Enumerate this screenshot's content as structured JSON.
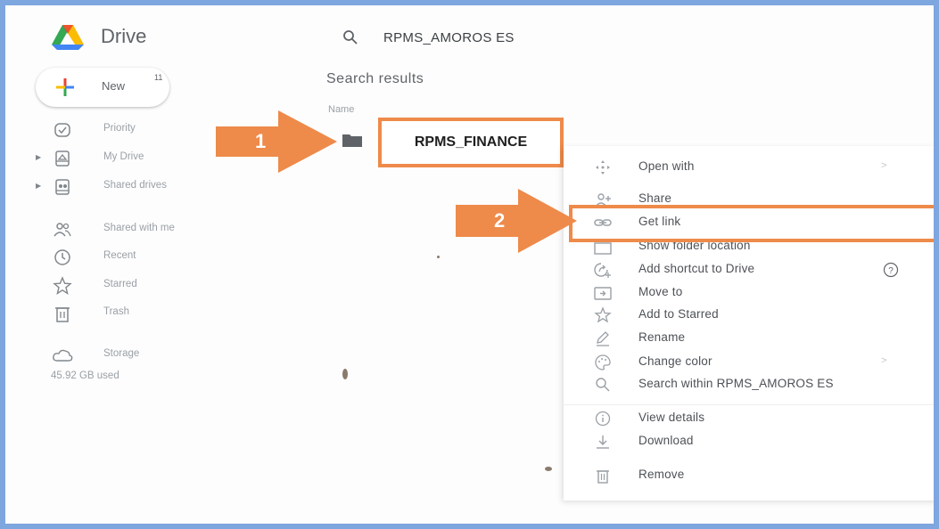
{
  "header": {
    "brand": "Drive",
    "search_query": "RPMS_AMOROS ES"
  },
  "new_button": {
    "label": "New",
    "badge": "11"
  },
  "sidebar": {
    "items": [
      {
        "label": "Priority",
        "icon": "priority-icon"
      },
      {
        "label": "My Drive",
        "icon": "my-drive-icon"
      },
      {
        "label": "Shared drives",
        "icon": "shared-drives-icon"
      },
      {
        "label": "Shared with me",
        "icon": "shared-with-me-icon"
      },
      {
        "label": "Recent",
        "icon": "clock-icon"
      },
      {
        "label": "Starred",
        "icon": "star-icon"
      },
      {
        "label": "Trash",
        "icon": "trash-icon"
      },
      {
        "label": "Storage",
        "icon": "cloud-icon"
      }
    ],
    "storage_used": "45.92 GB used"
  },
  "main": {
    "title": "Search results",
    "column_name": "Name",
    "result_folder": "RPMS_FINANCE"
  },
  "annotations": {
    "step1": "1",
    "step2": "2",
    "highlight_color": "#ee8a4a"
  },
  "context_menu": {
    "items": [
      {
        "label": "Open with",
        "icon": "open-with-icon"
      },
      {
        "label": "Share",
        "icon": "share-icon"
      },
      {
        "label": "Get link",
        "icon": "link-icon"
      },
      {
        "label": "Show folder location",
        "icon": "folder-location-icon"
      },
      {
        "label": "Add shortcut to Drive",
        "icon": "add-shortcut-icon"
      },
      {
        "label": "Move to",
        "icon": "move-to-icon"
      },
      {
        "label": "Add to Starred",
        "icon": "star-icon"
      },
      {
        "label": "Rename",
        "icon": "rename-icon"
      },
      {
        "label": "Change color",
        "icon": "palette-icon"
      },
      {
        "label": "Search within RPMS_AMOROS ES",
        "icon": "search-icon"
      },
      {
        "label": "View details",
        "icon": "info-icon"
      },
      {
        "label": "Download",
        "icon": "download-icon"
      },
      {
        "label": "Remove",
        "icon": "trash-icon"
      }
    ]
  }
}
